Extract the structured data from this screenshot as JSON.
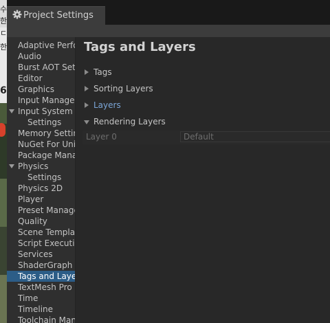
{
  "background": {
    "glyphs": [
      "수",
      "한",
      "ㄷ",
      "한",
      "6"
    ]
  },
  "window": {
    "tab_title": "Project Settings",
    "icon": "gear-icon"
  },
  "sidebar": {
    "items": [
      {
        "label": "Adaptive Performance",
        "indent": 0,
        "expandable": false,
        "selected": false
      },
      {
        "label": "Audio",
        "indent": 0,
        "expandable": false,
        "selected": false
      },
      {
        "label": "Burst AOT Settings",
        "indent": 0,
        "expandable": false,
        "selected": false
      },
      {
        "label": "Editor",
        "indent": 0,
        "expandable": false,
        "selected": false
      },
      {
        "label": "Graphics",
        "indent": 0,
        "expandable": false,
        "selected": false
      },
      {
        "label": "Input Manager",
        "indent": 0,
        "expandable": false,
        "selected": false
      },
      {
        "label": "Input System Package",
        "indent": 0,
        "expandable": true,
        "selected": false
      },
      {
        "label": "Settings",
        "indent": 1,
        "expandable": false,
        "selected": false
      },
      {
        "label": "Memory Settings",
        "indent": 0,
        "expandable": false,
        "selected": false
      },
      {
        "label": "NuGet For Unity",
        "indent": 0,
        "expandable": false,
        "selected": false
      },
      {
        "label": "Package Manager",
        "indent": 0,
        "expandable": false,
        "selected": false
      },
      {
        "label": "Physics",
        "indent": 0,
        "expandable": true,
        "selected": false
      },
      {
        "label": "Settings",
        "indent": 1,
        "expandable": false,
        "selected": false
      },
      {
        "label": "Physics 2D",
        "indent": 0,
        "expandable": false,
        "selected": false
      },
      {
        "label": "Player",
        "indent": 0,
        "expandable": false,
        "selected": false
      },
      {
        "label": "Preset Manager",
        "indent": 0,
        "expandable": false,
        "selected": false
      },
      {
        "label": "Quality",
        "indent": 0,
        "expandable": false,
        "selected": false
      },
      {
        "label": "Scene Template",
        "indent": 0,
        "expandable": false,
        "selected": false
      },
      {
        "label": "Script Execution Order",
        "indent": 0,
        "expandable": false,
        "selected": false
      },
      {
        "label": "Services",
        "indent": 0,
        "expandable": false,
        "selected": false
      },
      {
        "label": "ShaderGraph",
        "indent": 0,
        "expandable": false,
        "selected": false
      },
      {
        "label": "Tags and Layers",
        "indent": 0,
        "expandable": false,
        "selected": true
      },
      {
        "label": "TextMesh Pro",
        "indent": 0,
        "expandable": false,
        "selected": false
      },
      {
        "label": "Time",
        "indent": 0,
        "expandable": false,
        "selected": false
      },
      {
        "label": "Timeline",
        "indent": 0,
        "expandable": false,
        "selected": false
      },
      {
        "label": "Toolchain Management",
        "indent": 0,
        "expandable": false,
        "selected": false
      }
    ]
  },
  "content": {
    "title": "Tags and Layers",
    "sections": [
      {
        "label": "Tags",
        "expanded": false,
        "highlight": false
      },
      {
        "label": "Sorting Layers",
        "expanded": false,
        "highlight": false
      },
      {
        "label": "Layers",
        "expanded": false,
        "highlight": true
      },
      {
        "label": "Rendering Layers",
        "expanded": true,
        "highlight": false
      }
    ],
    "rendering_layers": {
      "row_label": "Layer 0",
      "value": "Default"
    }
  },
  "colors": {
    "accent_link": "#7ba6d8",
    "selected_bg": "#2c5d87"
  }
}
